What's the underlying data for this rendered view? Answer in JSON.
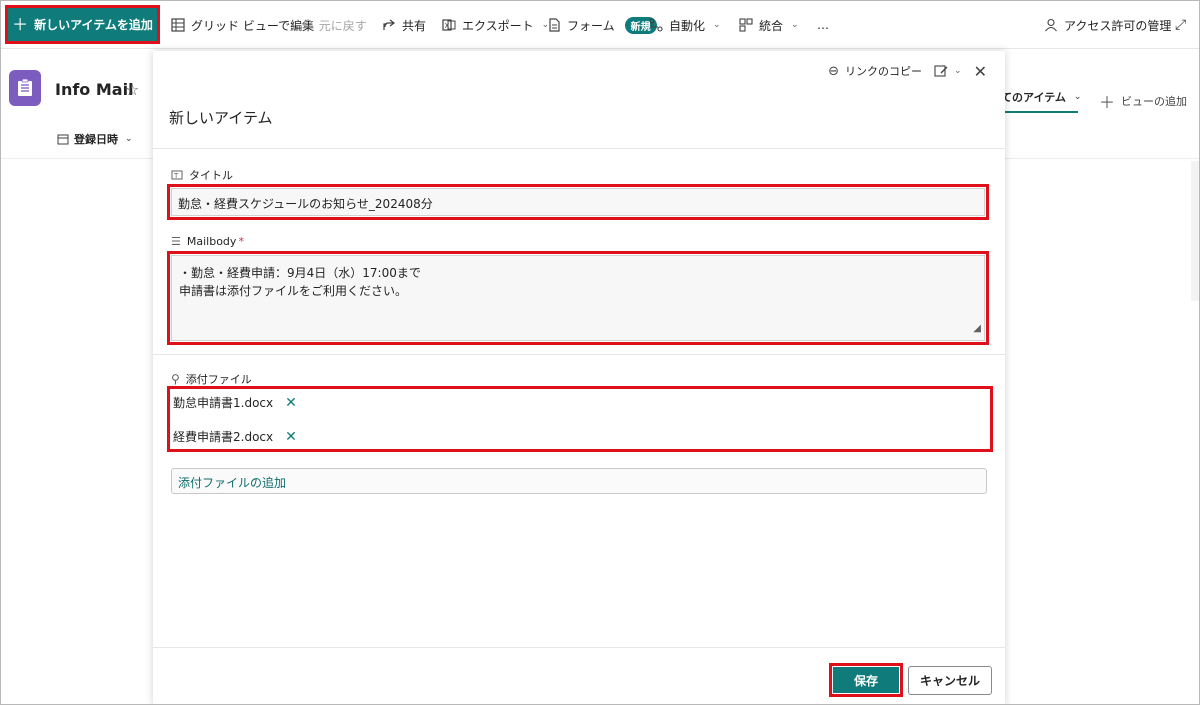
{
  "toolbar": {
    "new_item": "新しいアイテムを追加",
    "grid_edit": "グリッド ビューで編集",
    "undo": "元に戻す",
    "share": "共有",
    "export": "エクスポート",
    "form": "フォーム",
    "form_badge": "新規",
    "automate": "自動化",
    "integrate": "統合",
    "more": "…",
    "access": "アクセス許可の管理"
  },
  "list": {
    "title": "Info Mail",
    "column_header": "登録日時",
    "view_tab": "てのアイテム",
    "add_view": "ビューの追加"
  },
  "panel": {
    "copy_link": "リンクのコピー",
    "title": "新しいアイテム",
    "fields": {
      "title_label": "タイトル",
      "title_value": "勤怠・経費スケジュールのお知らせ_202408分",
      "mailbody_label": "Mailbody",
      "mailbody_required": "*",
      "mailbody_line1": "・勤怠・経費申請：9月4日（水）17:00まで",
      "mailbody_line2": "申請書は添付ファイルをご利用ください。",
      "attachments_label": "添付ファイル",
      "attachments": [
        "勤怠申請書1.docx",
        "経費申請書2.docx"
      ],
      "add_attachment": "添付ファイルの追加"
    },
    "save": "保存",
    "cancel": "キャンセル"
  },
  "colors": {
    "accent": "#0f7b7b",
    "highlight": "#e0101a",
    "app_icon": "#7c5cbf"
  }
}
